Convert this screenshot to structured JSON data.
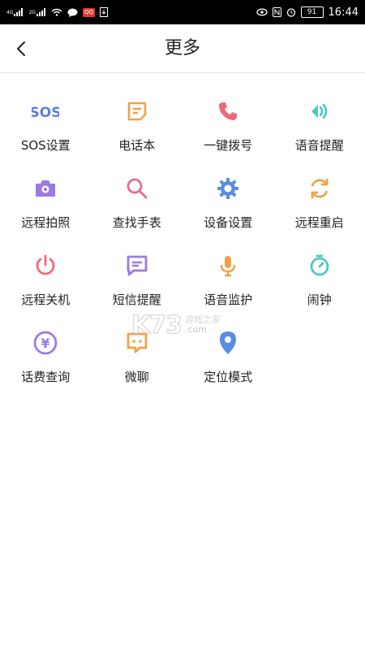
{
  "status_bar": {
    "net1": "4G",
    "net2": "2G",
    "battery": "91",
    "time": "16:44",
    "badge": "QQ"
  },
  "header": {
    "title": "更多"
  },
  "colors": {
    "sos": "#5b7fe0",
    "phonebook": "#f0a24a",
    "dial": "#ee6a7b",
    "voice_reminder": "#4fc8c2",
    "camera": "#9b7be3",
    "find": "#e86c8c",
    "settings": "#5a8de0",
    "restart": "#f0a24a",
    "power": "#ee6a7b",
    "sms": "#9b7be3",
    "mic": "#f0a24a",
    "alarm": "#4fc8c2",
    "fee": "#9b7be3",
    "chat": "#f0a24a",
    "location": "#5a8de0"
  },
  "menu": [
    {
      "label": "SOS设置",
      "icon": "sos-icon",
      "icon_text": "SOS"
    },
    {
      "label": "电话本",
      "icon": "phonebook-icon"
    },
    {
      "label": "一键拨号",
      "icon": "phone-icon"
    },
    {
      "label": "语音提醒",
      "icon": "voice-icon"
    },
    {
      "label": "远程拍照",
      "icon": "camera-icon"
    },
    {
      "label": "查找手表",
      "icon": "search-icon"
    },
    {
      "label": "设备设置",
      "icon": "gear-icon"
    },
    {
      "label": "远程重启",
      "icon": "restart-icon"
    },
    {
      "label": "远程关机",
      "icon": "power-icon"
    },
    {
      "label": "短信提醒",
      "icon": "sms-icon"
    },
    {
      "label": "语音监护",
      "icon": "mic-icon"
    },
    {
      "label": "闹钟",
      "icon": "alarm-icon"
    },
    {
      "label": "话费查询",
      "icon": "fee-icon",
      "icon_text": "¥"
    },
    {
      "label": "微聊",
      "icon": "chat-icon"
    },
    {
      "label": "定位模式",
      "icon": "location-icon"
    }
  ],
  "watermark": {
    "brand": "K73",
    "name": "游戏之家",
    "domain": ".com"
  }
}
